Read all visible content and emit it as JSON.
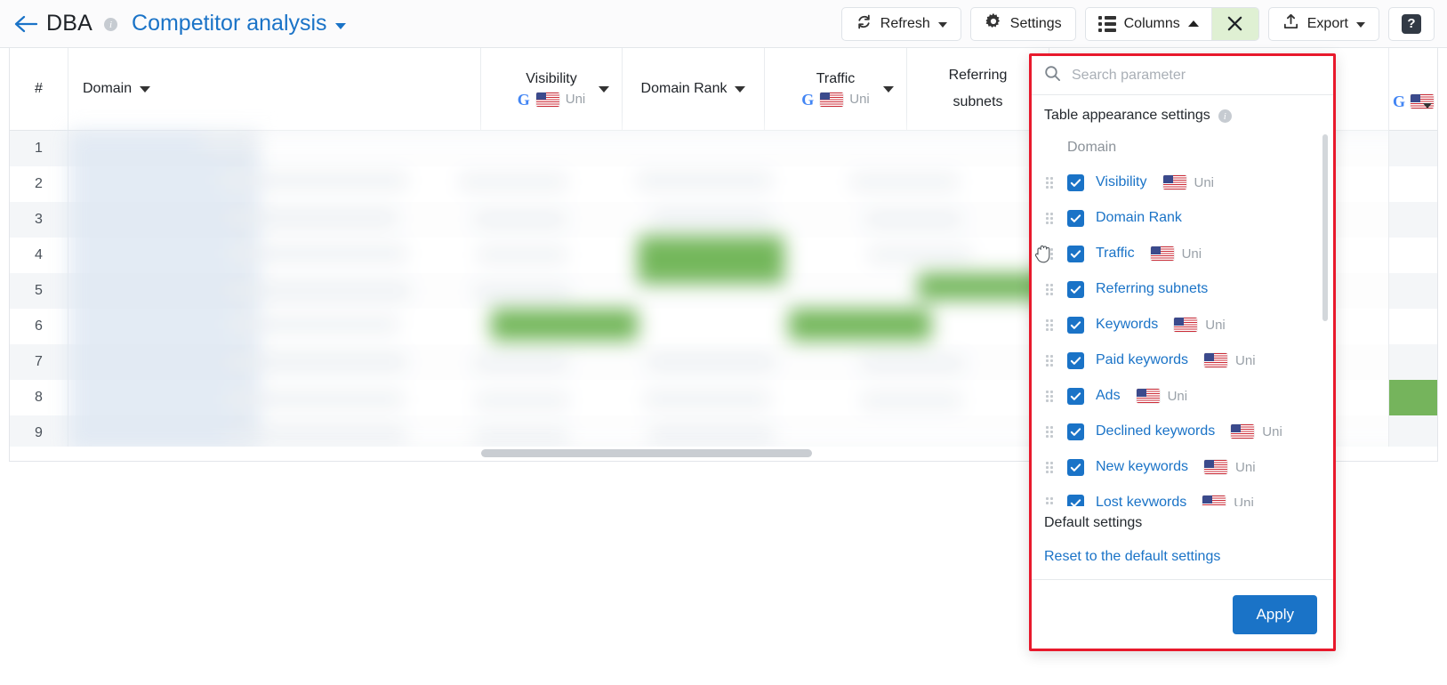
{
  "header": {
    "back_icon": "arrow-left-icon",
    "app_name": "DBA",
    "info_icon": "info-icon",
    "report_title": "Competitor analysis",
    "report_caret": "chevron-down-icon"
  },
  "toolbar": {
    "refresh_label": "Refresh",
    "refresh_icon": "refresh-icon",
    "settings_label": "Settings",
    "settings_icon": "gear-icon",
    "columns_label": "Columns",
    "columns_icon": "columns-icon",
    "columns_caret": "chevron-up-icon",
    "close_label": "✕",
    "close_icon": "close-icon",
    "export_label": "Export",
    "export_icon": "upload-icon",
    "help_label": "?",
    "help_icon": "question-mark-icon",
    "accent_blue": "#1a73c7",
    "close_bg": "#dff0d3"
  },
  "table": {
    "columns": [
      {
        "label": "#",
        "type": "index"
      },
      {
        "label": "Domain",
        "type": "text",
        "sortable": true
      },
      {
        "label": "Visibility",
        "engine": "G",
        "region": "Uni",
        "flag": "us-flag"
      },
      {
        "label": "Domain Rank",
        "sortable": true
      },
      {
        "label": "Traffic",
        "engine": "G",
        "region": "Uni",
        "flag": "us-flag"
      },
      {
        "label": "Referring subnets"
      }
    ],
    "row_numbers": [
      "1",
      "2",
      "3",
      "4",
      "5",
      "6",
      "7",
      "8",
      "9"
    ],
    "blurred_content": true,
    "highlight_color": "#5cab3f",
    "cell_highlight_color": "#75b45c"
  },
  "panel": {
    "search_placeholder": "Search parameter",
    "search_value": "",
    "search_icon": "search-icon",
    "section_title": "Table appearance settings",
    "section_info_icon": "info-icon",
    "group_label": "Domain",
    "options": [
      {
        "label": "Visibility",
        "checked": true,
        "region": "Uni",
        "flag": "us-flag"
      },
      {
        "label": "Domain Rank",
        "checked": true,
        "region": "",
        "flag": ""
      },
      {
        "label": "Traffic",
        "checked": true,
        "region": "Uni",
        "flag": "us-flag"
      },
      {
        "label": "Referring subnets",
        "checked": true,
        "region": "",
        "flag": ""
      },
      {
        "label": "Keywords",
        "checked": true,
        "region": "Uni",
        "flag": "us-flag"
      },
      {
        "label": "Paid keywords",
        "checked": true,
        "region": "Uni",
        "flag": "us-flag"
      },
      {
        "label": "Ads",
        "checked": true,
        "region": "Uni",
        "flag": "us-flag"
      },
      {
        "label": "Declined keywords",
        "checked": true,
        "region": "Uni",
        "flag": "us-flag"
      },
      {
        "label": "New keywords",
        "checked": true,
        "region": "Uni",
        "flag": "us-flag"
      },
      {
        "label": "Lost keywords",
        "checked": true,
        "region": "Uni",
        "flag": "us-flag"
      }
    ],
    "default_settings_label": "Default settings",
    "reset_link_label": "Reset to the default settings",
    "apply_label": "Apply",
    "border_color": "#e8192c"
  },
  "cursor": {
    "type": "grab-hand-cursor"
  }
}
